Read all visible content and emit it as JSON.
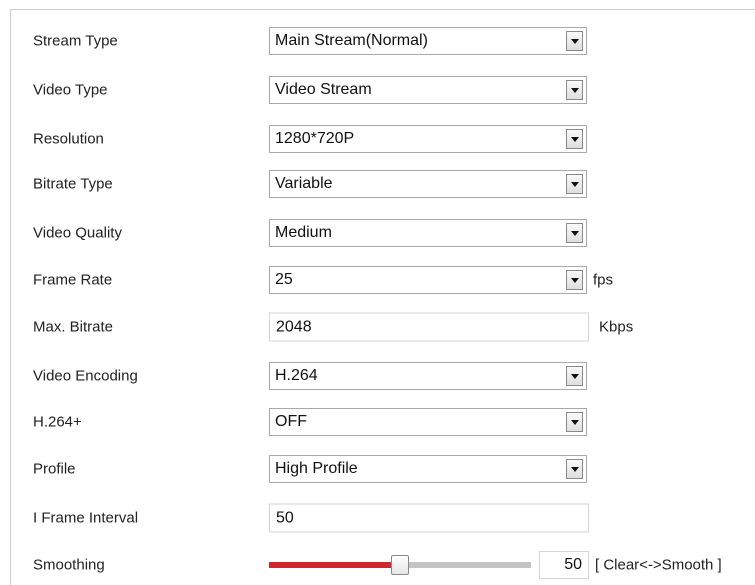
{
  "form": {
    "stream_type": {
      "label": "Stream Type",
      "value": "Main Stream(Normal)"
    },
    "video_type": {
      "label": "Video Type",
      "value": "Video Stream"
    },
    "resolution": {
      "label": "Resolution",
      "value": "1280*720P"
    },
    "bitrate_type": {
      "label": "Bitrate Type",
      "value": "Variable"
    },
    "video_quality": {
      "label": "Video Quality",
      "value": "Medium"
    },
    "frame_rate": {
      "label": "Frame Rate",
      "value": "25",
      "unit": "fps"
    },
    "max_bitrate": {
      "label": "Max. Bitrate",
      "value": "2048",
      "unit": "Kbps"
    },
    "video_encoding": {
      "label": "Video Encoding",
      "value": "H.264"
    },
    "h264_plus": {
      "label": "H.264+",
      "value": "OFF"
    },
    "profile": {
      "label": "Profile",
      "value": "High Profile"
    },
    "i_frame_interval": {
      "label": "I Frame Interval",
      "value": "50"
    },
    "smoothing": {
      "label": "Smoothing",
      "value": "50",
      "range_hint": "[ Clear<->Smooth ]",
      "fraction": 0.5
    }
  },
  "colors": {
    "slider_fill": "#d2262e",
    "slider_track": "#c4c4c4"
  }
}
